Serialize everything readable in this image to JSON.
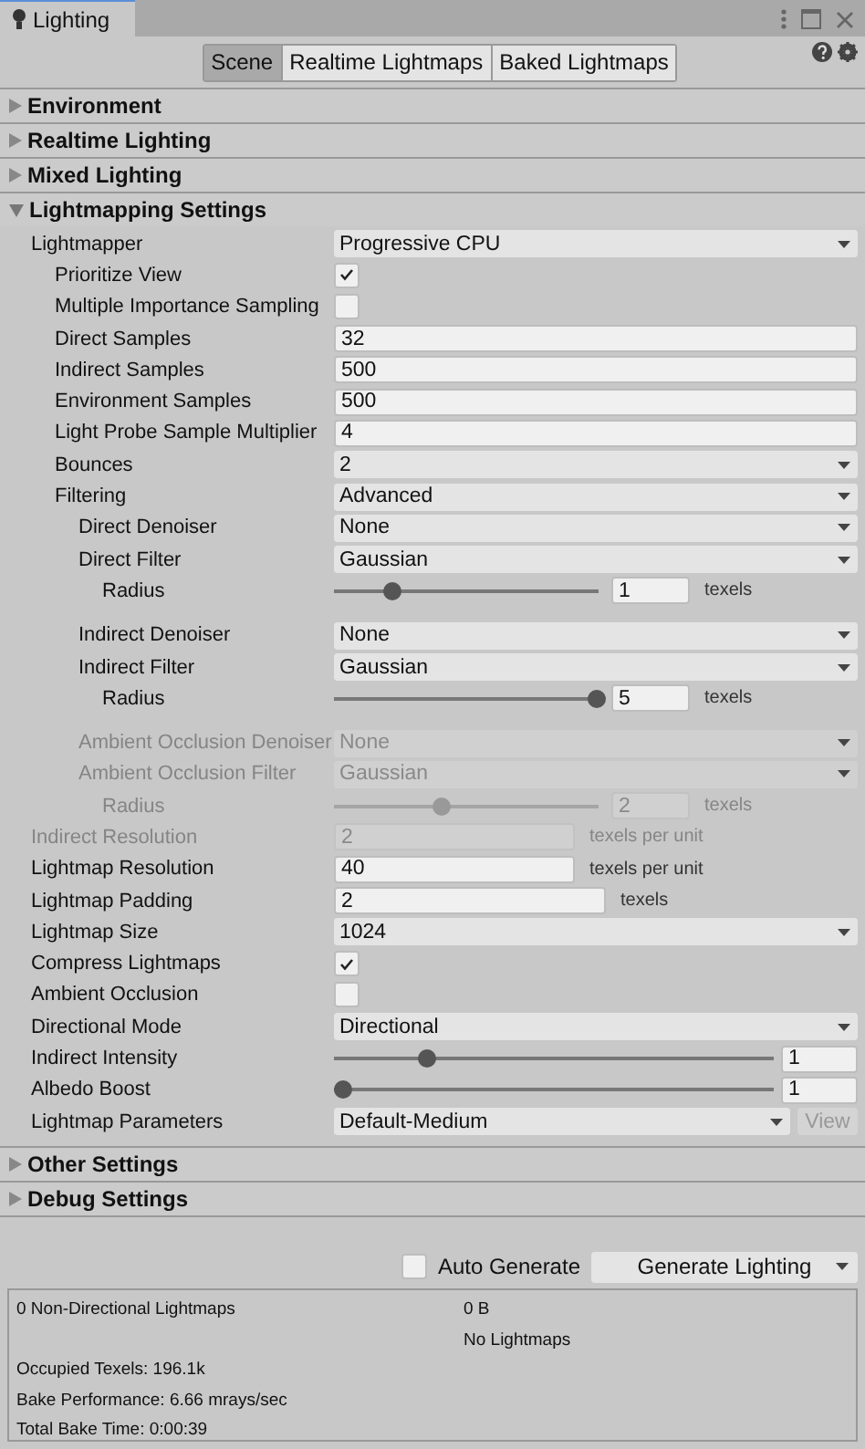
{
  "window": {
    "tab": "Lighting"
  },
  "toolbar": {
    "tabs": [
      {
        "label": "Scene",
        "selected": true
      },
      {
        "label": "Realtime Lightmaps",
        "selected": false
      },
      {
        "label": "Baked Lightmaps",
        "selected": false
      }
    ]
  },
  "sections": [
    {
      "title": "Environment",
      "expanded": false
    },
    {
      "title": "Realtime Lighting",
      "expanded": false
    },
    {
      "title": "Mixed Lighting",
      "expanded": false
    },
    {
      "title": "Lightmapping Settings",
      "expanded": true,
      "properties": [
        {
          "label": "Lightmapper",
          "kind": "dropdown",
          "value": "Progressive CPU",
          "disabled": false,
          "children": [
            {
              "label": "Prioritize View",
              "kind": "checkbox",
              "checked": true,
              "disabled": false
            },
            {
              "label": "Multiple Importance Sampling",
              "kind": "checkbox",
              "checked": false,
              "disabled": false
            },
            {
              "label": "Direct Samples",
              "kind": "number",
              "value": "32",
              "disabled": false
            },
            {
              "label": "Indirect Samples",
              "kind": "number",
              "value": "500",
              "disabled": false
            },
            {
              "label": "Environment Samples",
              "kind": "number",
              "value": "500",
              "disabled": false
            },
            {
              "label": "Light Probe Sample Multiplier",
              "kind": "number",
              "value": "4",
              "disabled": false
            },
            {
              "label": "Bounces",
              "kind": "dropdown",
              "value": "2",
              "disabled": false
            },
            {
              "label": "Filtering",
              "kind": "dropdown",
              "value": "Advanced",
              "disabled": false,
              "children": [
                {
                  "label": "Direct Denoiser",
                  "kind": "dropdown",
                  "value": "None",
                  "disabled": false
                },
                {
                  "label": "Direct Filter",
                  "kind": "dropdown",
                  "value": "Gaussian",
                  "disabled": false,
                  "children": [
                    {
                      "label": "Radius",
                      "kind": "slider",
                      "level": 0.22,
                      "value": "1",
                      "unit": "texels",
                      "disabled": false
                    }
                  ]
                },
                {
                  "label": "Indirect Denoiser",
                  "kind": "dropdown",
                  "value": "None",
                  "disabled": false
                },
                {
                  "label": "Indirect Filter",
                  "kind": "dropdown",
                  "value": "Gaussian",
                  "disabled": false,
                  "children": [
                    {
                      "label": "Radius",
                      "kind": "slider",
                      "level": 0.99,
                      "value": "5",
                      "unit": "texels",
                      "disabled": false
                    }
                  ]
                },
                {
                  "label": "Ambient Occlusion Denoiser",
                  "kind": "dropdown",
                  "value": "None",
                  "disabled": true
                },
                {
                  "label": "Ambient Occlusion Filter",
                  "kind": "dropdown",
                  "value": "Gaussian",
                  "disabled": true,
                  "children": [
                    {
                      "label": "Radius",
                      "kind": "slider",
                      "level": 0.41,
                      "value": "2",
                      "unit": "texels",
                      "disabled": true
                    }
                  ]
                }
              ]
            }
          ]
        },
        {
          "label": "Indirect Resolution",
          "kind": "unit_field",
          "value": "2",
          "unit": "texels per unit",
          "disabled": true
        },
        {
          "label": "Lightmap Resolution",
          "kind": "unit_field",
          "value": "40",
          "unit": "texels per unit",
          "disabled": false
        },
        {
          "label": "Lightmap Padding",
          "kind": "wide_unit_field",
          "value": "2",
          "unit": "texels",
          "disabled": false
        },
        {
          "label": "Lightmap Size",
          "kind": "dropdown",
          "value": "1024",
          "disabled": false
        },
        {
          "label": "Compress Lightmaps",
          "kind": "checkbox",
          "checked": true,
          "disabled": false
        },
        {
          "label": "Ambient Occlusion",
          "kind": "checkbox",
          "checked": false,
          "disabled": false
        },
        {
          "label": "Directional Mode",
          "kind": "dropdown",
          "value": "Directional",
          "disabled": false
        },
        {
          "label": "Indirect Intensity",
          "kind": "long_slider",
          "level": 0.21,
          "value": "1",
          "disabled": false
        },
        {
          "label": "Albedo Boost",
          "kind": "long_slider",
          "level": 0.02,
          "value": "1",
          "disabled": false
        },
        {
          "label": "Lightmap Parameters",
          "kind": "asset_dropdown",
          "value": "Default-Medium",
          "button": {
            "label": "View",
            "disabled": true
          },
          "disabled": false
        }
      ]
    },
    {
      "title": "Other Settings",
      "expanded": false
    },
    {
      "title": "Debug Settings",
      "expanded": false
    }
  ],
  "footer": {
    "auto_generate": {
      "label": "Auto Generate",
      "checked": false
    },
    "generate_button": "Generate Lighting",
    "stats": [
      {
        "column_1": "0 Non-Directional Lightmaps",
        "column_2": "0 B"
      },
      {
        "column_2": "No Lightmaps"
      },
      {
        "column_1": "Occupied Texels: 196.1k"
      },
      {
        "column_1": "Bake Performance: 6.66 mrays/sec"
      },
      {
        "column_1": "Total Bake Time: 0:00:39"
      }
    ]
  }
}
